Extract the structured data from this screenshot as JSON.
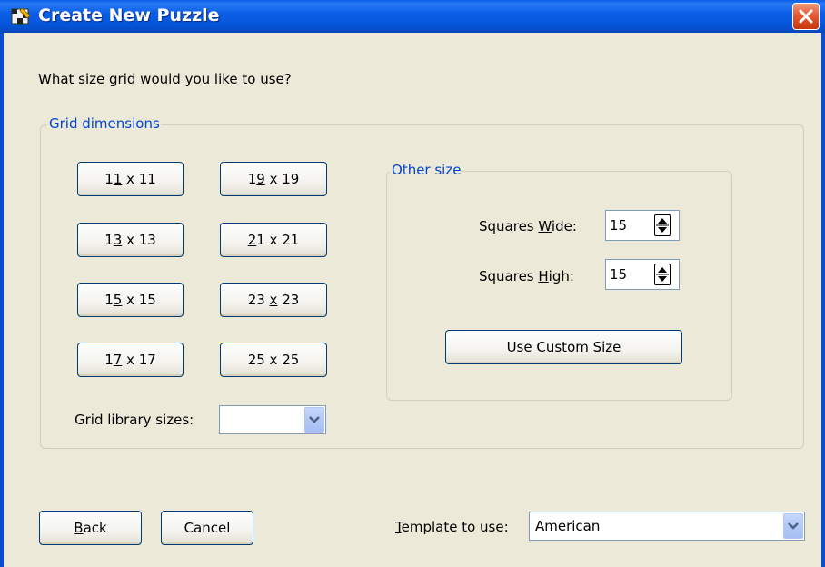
{
  "window": {
    "title": "Create New Puzzle",
    "app_icon": "puzzle-grid-icon",
    "close_icon": "close-icon"
  },
  "prompt": "What size grid would you like to  use?",
  "grid_dimensions": {
    "legend": "Grid dimensions",
    "buttons": [
      {
        "pre": "1",
        "acc": "1",
        "post": " x 11"
      },
      {
        "pre": "1",
        "acc": "9",
        "post": " x 19"
      },
      {
        "pre": "1",
        "acc": "3",
        "post": " x 13"
      },
      {
        "pre": "",
        "acc": "2",
        "post": "1 x 21"
      },
      {
        "pre": "1",
        "acc": "5",
        "post": " x 15"
      },
      {
        "pre": "23 ",
        "acc": "x",
        "post": " 23"
      },
      {
        "pre": "1",
        "acc": "7",
        "post": " x 17"
      },
      {
        "pre": "25 x 25",
        "acc": "",
        "post": ""
      }
    ],
    "library_label": "Grid library sizes:",
    "library_value": ""
  },
  "other_size": {
    "legend": "Other size",
    "wide_label_pre": "Squares ",
    "wide_label_acc": "W",
    "wide_label_post": "ide:",
    "wide_value": "15",
    "high_label_pre": "Squares ",
    "high_label_acc": "H",
    "high_label_post": "igh:",
    "high_value": "15",
    "custom_pre": "Use ",
    "custom_acc": "C",
    "custom_post": "ustom Size"
  },
  "footer": {
    "back_acc": "B",
    "back_post": "ack",
    "cancel": "Cancel",
    "template_acc": "T",
    "template_post": "emplate to use:",
    "template_value": "American"
  }
}
